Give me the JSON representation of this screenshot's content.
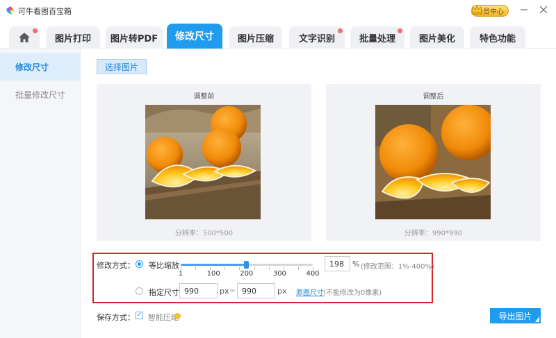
{
  "app": {
    "title": "可牛看图百宝箱",
    "vip_label": "会员中心"
  },
  "tabs": [
    {
      "label": "",
      "icon": "home-icon",
      "dot": true
    },
    {
      "label": "图片打印",
      "dot": false
    },
    {
      "label": "图片转PDF",
      "dot": false
    },
    {
      "label": "修改尺寸",
      "dot": false,
      "active": true
    },
    {
      "label": "图片压缩",
      "dot": false
    },
    {
      "label": "文字识别",
      "dot": true
    },
    {
      "label": "批量处理",
      "dot": true
    },
    {
      "label": "图片美化",
      "dot": false
    },
    {
      "label": "特色功能",
      "dot": false
    }
  ],
  "sidebar": {
    "items": [
      {
        "label": "修改尺寸",
        "active": true
      },
      {
        "label": "批量修改尺寸",
        "active": false
      }
    ]
  },
  "main": {
    "select_button": "选择图片",
    "before": {
      "title": "调整前",
      "resolution": "分辨率：500*500"
    },
    "after": {
      "title": "调整后",
      "resolution": "分辨率：990*990"
    }
  },
  "settings": {
    "mode_label": "修改方式：",
    "scale_option": "等比缩放",
    "slider": {
      "value": 198,
      "min": 1,
      "max": 400,
      "ticks": [
        "1",
        "100",
        "200",
        "300",
        "400"
      ]
    },
    "percent_value": "198",
    "percent_unit": "%",
    "percent_hint": "(修改范围：1%-400%)",
    "size_option": "指定尺寸",
    "width_value": "990",
    "height_value": "990",
    "px_unit": "px",
    "link_symbol": "∞",
    "original_size_link": "原图尺寸",
    "size_hint": "(不能修改为0像素)"
  },
  "save": {
    "label": "保存方式：",
    "smart_compress": "智能压缩",
    "smart_compress_checked": true,
    "export_button": "导出图片"
  },
  "colors": {
    "accent": "#1f9bf0",
    "highlight_border": "#d8252b",
    "dot": "#f46f6f"
  }
}
